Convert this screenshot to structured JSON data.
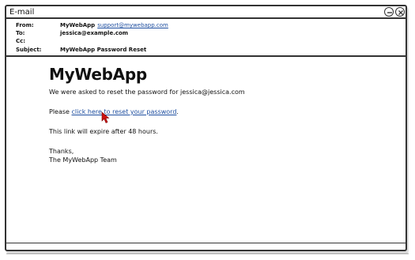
{
  "window": {
    "title": "E-mail"
  },
  "header": {
    "from_label": "From:",
    "from_name": "MyWebApp",
    "from_email": "support@mywebapp.com",
    "to_label": "To:",
    "to_value": "jessica@example.com",
    "cc_label": "Cc:",
    "cc_value": "",
    "subject_label": "Subject:",
    "subject_value": "MyWebApp Password Reset"
  },
  "message": {
    "brand": "MyWebApp",
    "intro": "We were asked to reset the password for jessica@jessica.com",
    "please": "Please",
    "link_text": "click here to reset your password",
    "period": ".",
    "expire": "This link will expire after 48 hours.",
    "thanks": "Thanks,",
    "signature": "The MyWebApp Team"
  },
  "colors": {
    "link": "#1f4fa0",
    "cursor": "#cc1111",
    "border": "#333333"
  },
  "icons": {
    "minimize": "minimize-icon",
    "close": "close-icon",
    "cursor": "mouse-pointer-icon"
  }
}
